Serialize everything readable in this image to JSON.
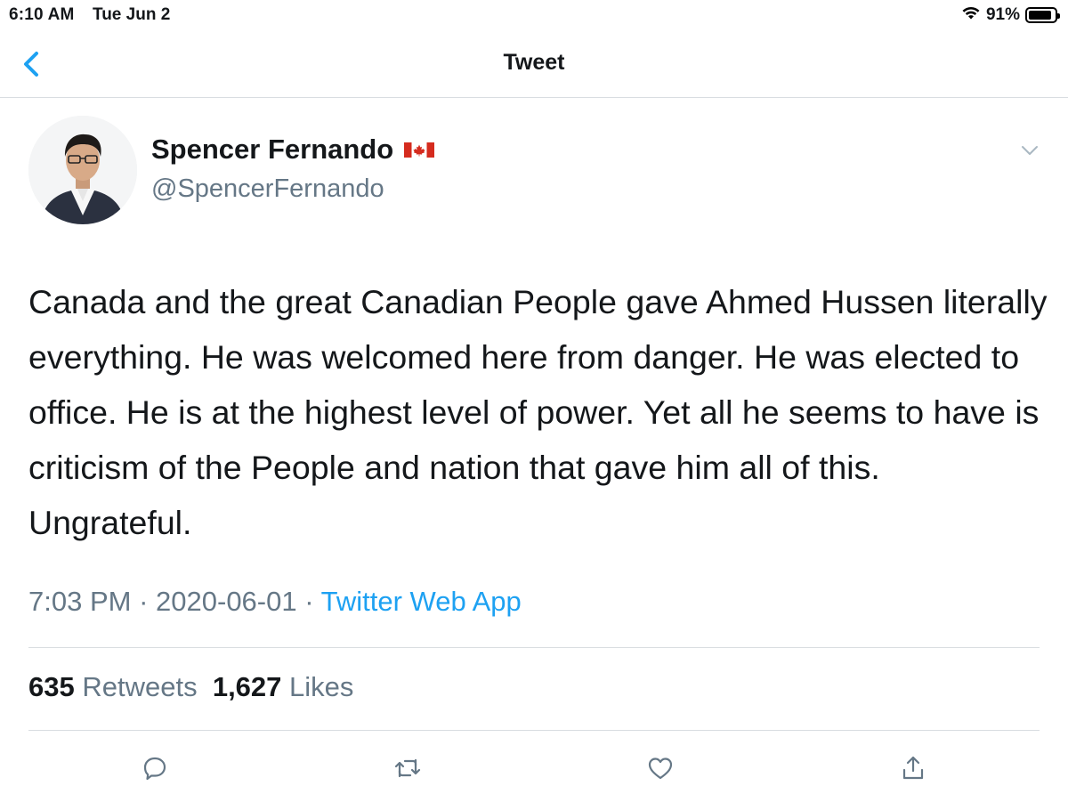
{
  "status_bar": {
    "time": "6:10 AM",
    "date": "Tue Jun 2",
    "battery_percent": "91%",
    "battery_level": 0.91,
    "icons": [
      "wifi-icon",
      "battery-icon"
    ]
  },
  "nav": {
    "back_icon": "chevron-left-icon",
    "title": "Tweet"
  },
  "author": {
    "display_name": "Spencer Fernando",
    "flag_icon": "canada-flag-icon",
    "handle": "@SpencerFernando"
  },
  "tweet": {
    "text": "Canada and the great Canadian People gave Ahmed Hussen literally everything. He was welcomed here from danger. He was elected to office. He is at the highest level of power. Yet all he seems to have is criticism of the People and nation that gave him all of this. Ungrateful.",
    "time": "7:03 PM",
    "separator": "·",
    "date": "2020-06-01",
    "source": "Twitter Web App"
  },
  "stats": {
    "retweets_count": "635",
    "retweets_label": "Retweets",
    "likes_count": "1,627",
    "likes_label": "Likes"
  },
  "actions": [
    "reply-icon",
    "retweet-icon",
    "like-icon",
    "share-icon"
  ],
  "colors": {
    "accent": "#1da1f2",
    "text_primary": "#14171a",
    "text_secondary": "#657786",
    "divider": "#d9dde1"
  }
}
